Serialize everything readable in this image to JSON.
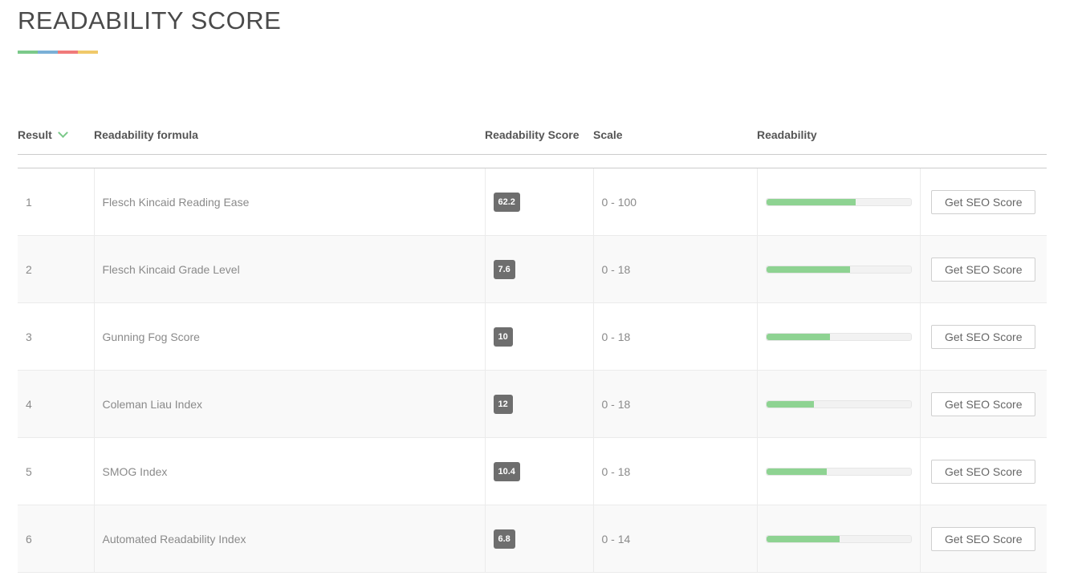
{
  "page": {
    "title": "READABILITY SCORE",
    "underline_colors": [
      "#7bc98a",
      "#7ab0d6",
      "#f07a7a",
      "#f0c96a"
    ]
  },
  "table": {
    "headers": {
      "result": "Result",
      "formula": "Readability formula",
      "score": "Readability Score",
      "scale": "Scale",
      "readability": "Readability"
    },
    "button_label": "Get SEO Score",
    "bar_color": "#8ed392",
    "badge_color": "#6e6e6e",
    "rows": [
      {
        "result": "1",
        "formula": "Flesch Kincaid Reading Ease",
        "score": "62.2",
        "scale": "0 - 100",
        "readability_fraction": 0.62
      },
      {
        "result": "2",
        "formula": "Flesch Kincaid Grade Level",
        "score": "7.6",
        "scale": "0 - 18",
        "readability_fraction": 0.58
      },
      {
        "result": "3",
        "formula": "Gunning Fog Score",
        "score": "10",
        "scale": "0 - 18",
        "readability_fraction": 0.44
      },
      {
        "result": "4",
        "formula": "Coleman Liau Index",
        "score": "12",
        "scale": "0 - 18",
        "readability_fraction": 0.33
      },
      {
        "result": "5",
        "formula": "SMOG Index",
        "score": "10.4",
        "scale": "0 - 18",
        "readability_fraction": 0.42
      },
      {
        "result": "6",
        "formula": "Automated Readability Index",
        "score": "6.8",
        "scale": "0 - 14",
        "readability_fraction": 0.51
      }
    ]
  }
}
